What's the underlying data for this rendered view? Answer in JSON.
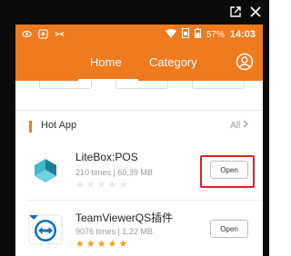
{
  "colors": {
    "accent": "#f07a1e",
    "highlight": "#e02020",
    "star_on": "#f39c12",
    "star_off": "#e8e8e8"
  },
  "window": {
    "icons": [
      "external-link-icon",
      "close-icon"
    ]
  },
  "status_bar": {
    "left_icons": [
      "eye-icon",
      "camera-icon",
      "antenna-icon"
    ],
    "right_icons": [
      "wifi-icon",
      "sim-icon",
      "battery-icon"
    ],
    "battery": "57%",
    "time": "14:03"
  },
  "header": {
    "tabs": [
      {
        "label": "Home",
        "active": true
      },
      {
        "label": "Category",
        "active": false
      }
    ],
    "profile_icon": "profile-icon"
  },
  "section": {
    "title": "Hot App",
    "all_label": "All"
  },
  "apps": [
    {
      "name": "LiteBox:POS",
      "meta": "210 times | 60,39 MB",
      "rating": 0,
      "button": "Open",
      "highlighted": true,
      "icon": "litebox-app-icon"
    },
    {
      "name": "TeamViewerQS插件",
      "meta": "9076 times | 1,22 MB",
      "rating": 5,
      "button": "Open",
      "highlighted": false,
      "icon": "teamviewer-app-icon"
    }
  ]
}
